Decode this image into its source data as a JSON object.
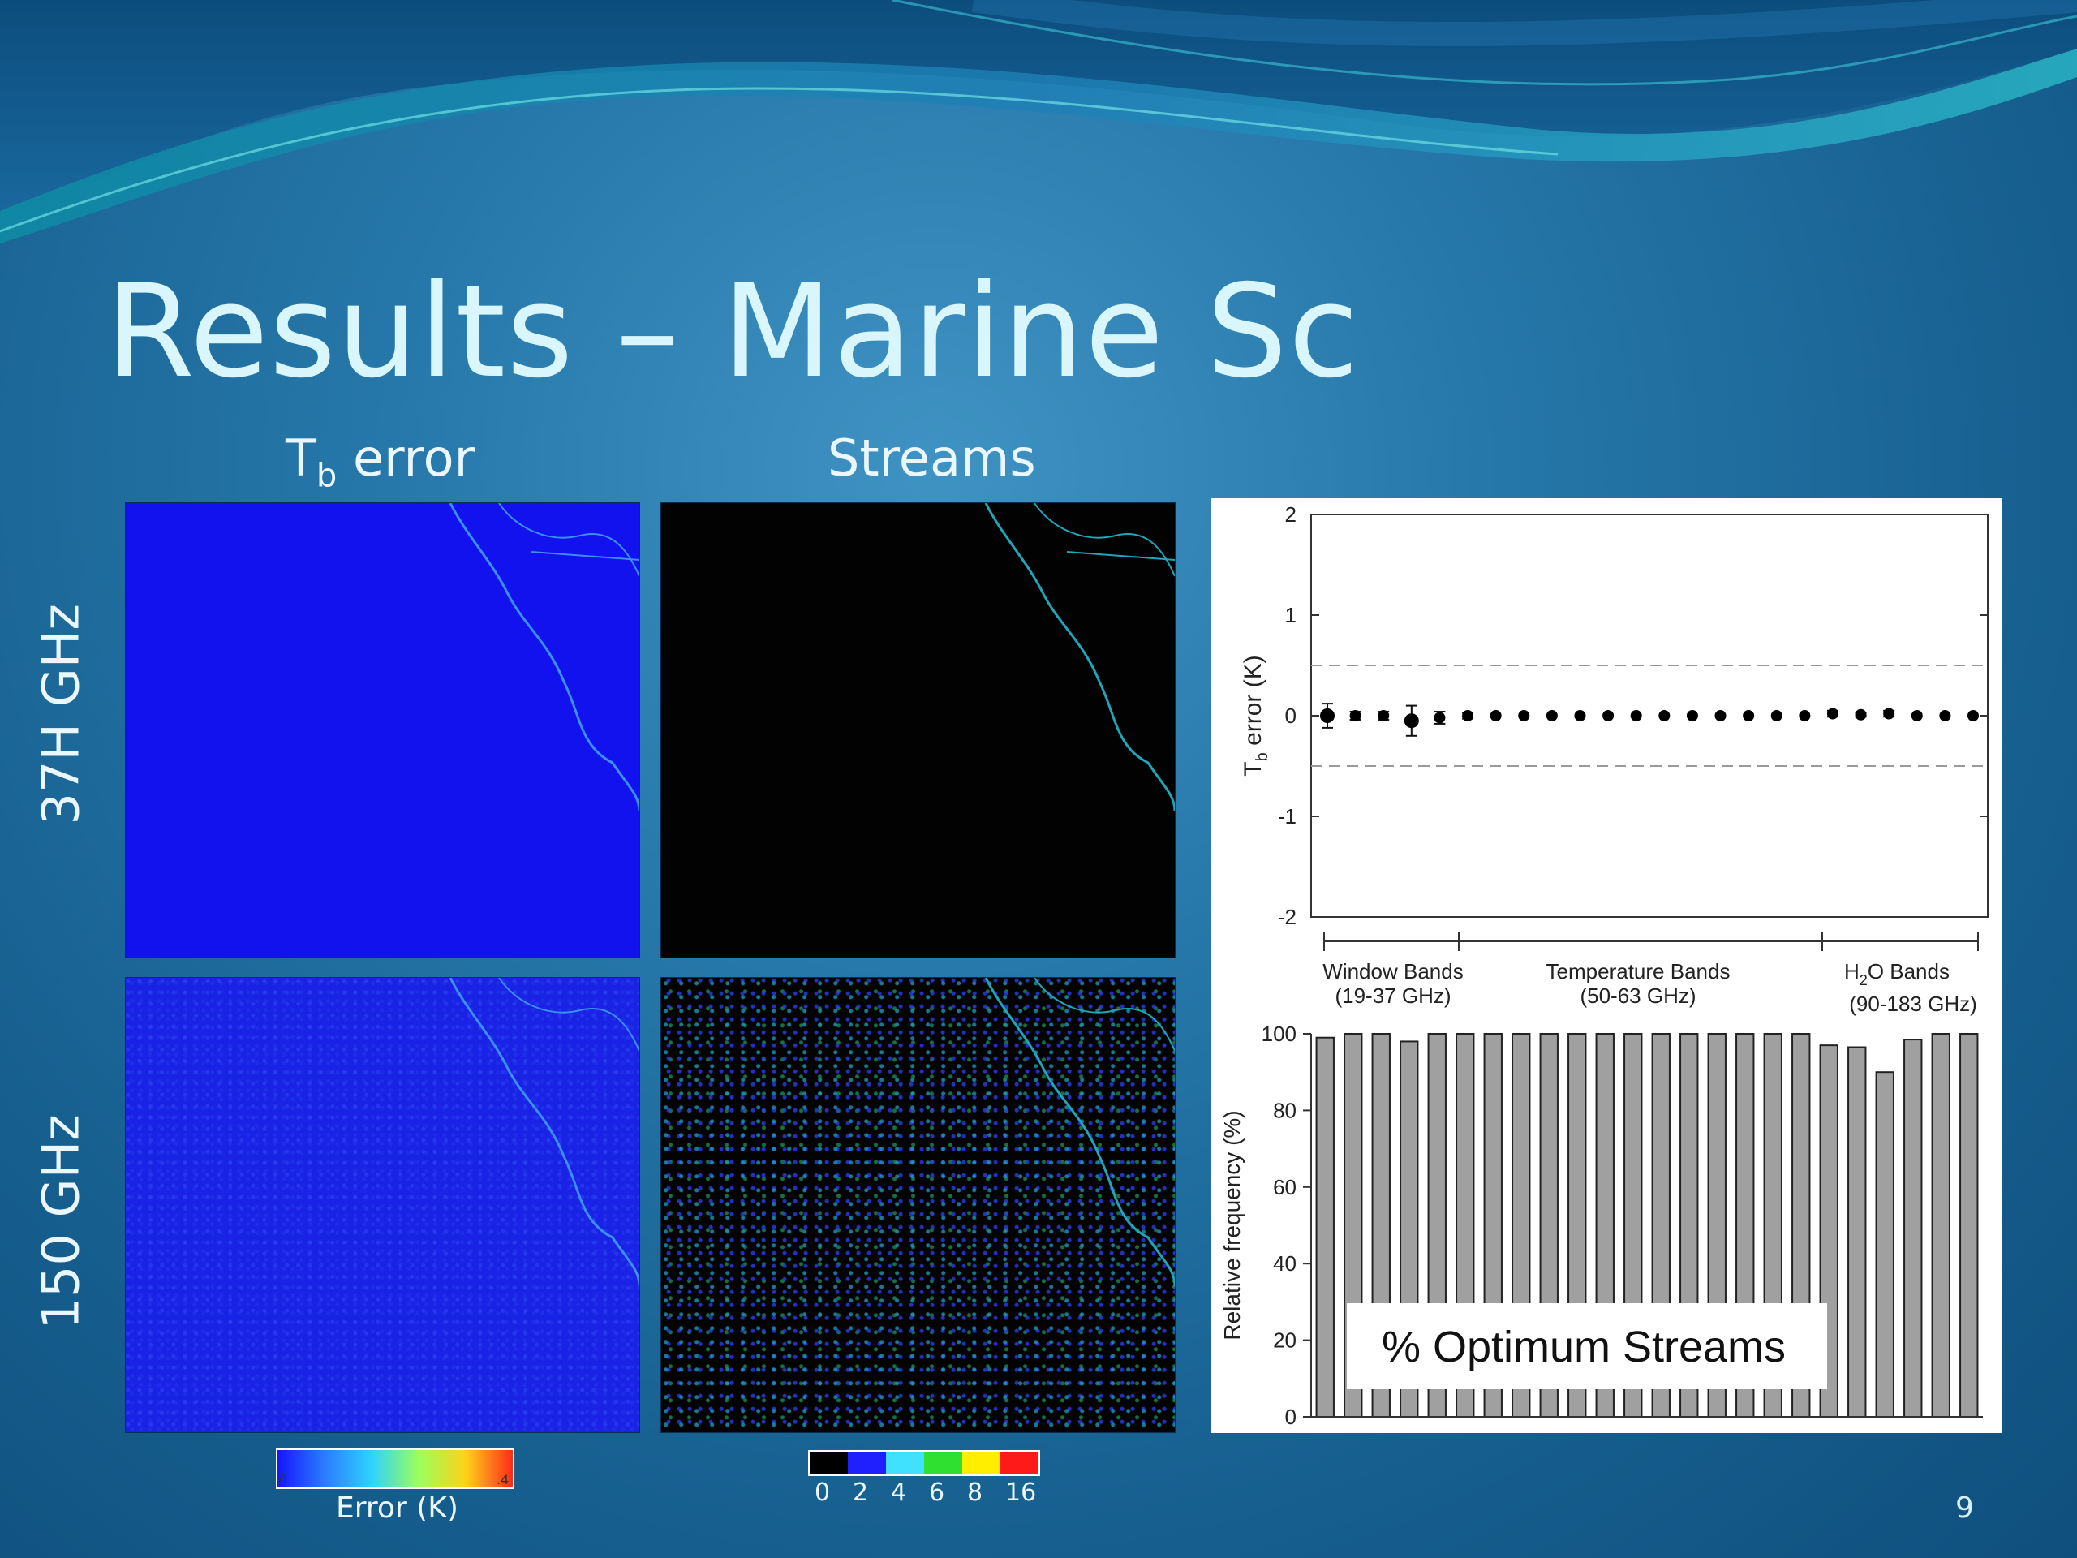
{
  "slide": {
    "title": "Results – Marine Sc",
    "page_number": "9",
    "column_headers": {
      "tb_error_main": "T",
      "tb_error_sub": "b",
      "tb_error_rest": " error",
      "streams": "Streams"
    },
    "row_labels": {
      "row1": "37H GHz",
      "row2": "150 GHz"
    },
    "colorbars": {
      "error": {
        "label": "Error (K)",
        "min_label": "0",
        "max_label": ".4",
        "colors": [
          "#1616ff",
          "#2a7cff",
          "#2ed2ff",
          "#9bff5a",
          "#ffd21a",
          "#ff2a1a"
        ]
      },
      "streams": {
        "ticks": [
          "0",
          "2",
          "4",
          "6",
          "8",
          "16"
        ],
        "colors": [
          "#000000",
          "#2020ff",
          "#40e0ff",
          "#30e030",
          "#ffee00",
          "#ff1a1a"
        ]
      }
    }
  },
  "chart_data": [
    {
      "type": "scatter",
      "ylabel_main": "T",
      "ylabel_sub": "b",
      "ylabel_rest": " error (K)",
      "ylim": [
        -2,
        2
      ],
      "yticks": [
        "2",
        "1",
        "0",
        "-1",
        "-2"
      ],
      "reference_lines": [
        0.5,
        -0.5
      ],
      "x": [
        1,
        2,
        3,
        4,
        5,
        6,
        7,
        8,
        9,
        10,
        11,
        12,
        13,
        14,
        15,
        16,
        17,
        18,
        19,
        20,
        21,
        22,
        23,
        24
      ],
      "values": [
        0,
        0,
        0,
        -0.05,
        -0.02,
        0,
        0,
        0,
        0,
        0,
        0,
        0,
        0,
        0,
        0,
        0,
        0,
        0,
        0.02,
        0.01,
        0.02,
        0,
        0,
        0
      ],
      "error": [
        0.12,
        0.04,
        0.04,
        0.15,
        0.06,
        0.03,
        0,
        0,
        0,
        0,
        0,
        0,
        0,
        0,
        0,
        0,
        0,
        0,
        0.03,
        0.02,
        0.03,
        0,
        0,
        0
      ],
      "band_groups": [
        {
          "name": "Window Bands",
          "range": "(19-37 GHz)"
        },
        {
          "name": "Temperature Bands",
          "range": "(50-63 GHz)"
        },
        {
          "name_main": "H",
          "name_sub": "2",
          "name_rest": "O Bands",
          "range": "(90-183 GHz)"
        }
      ]
    },
    {
      "type": "bar",
      "ylabel": "Relative frequency (%)",
      "ylim": [
        0,
        100
      ],
      "yticks": [
        "100",
        "80",
        "60",
        "40",
        "20",
        "0"
      ],
      "values": [
        99,
        100,
        100,
        98,
        100,
        100,
        100,
        100,
        100,
        100,
        100,
        100,
        100,
        100,
        100,
        100,
        100,
        100,
        97,
        96.5,
        90,
        98.5,
        100,
        100
      ],
      "annotation": "% Optimum Streams"
    }
  ]
}
